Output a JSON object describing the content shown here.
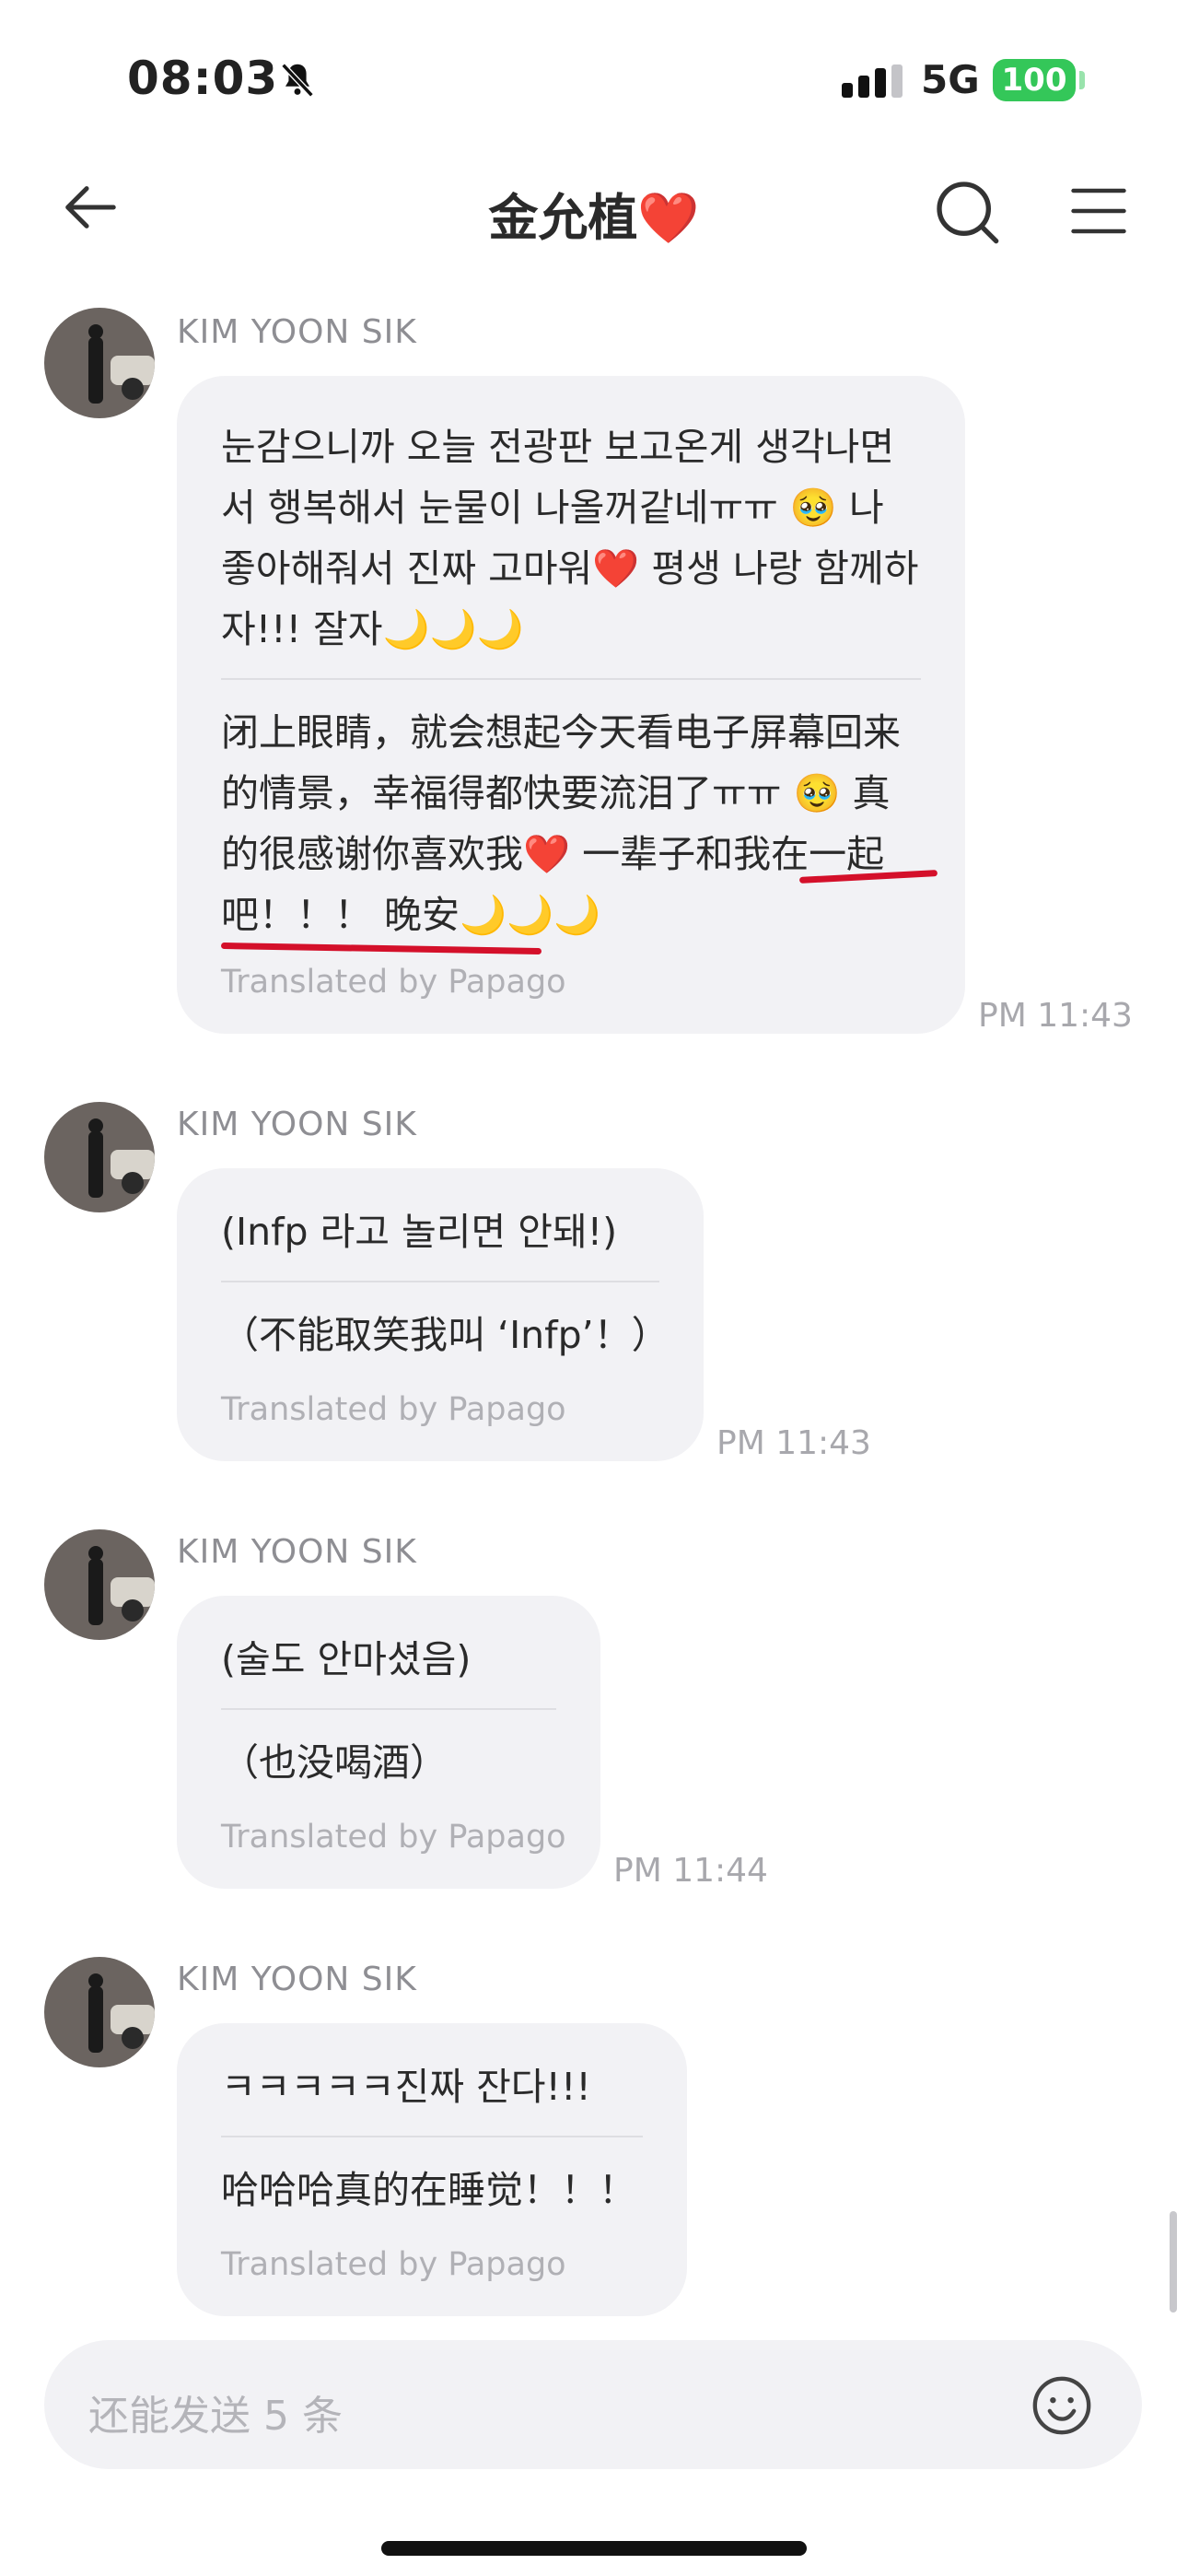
{
  "status_bar": {
    "time": "08:03",
    "network": "5G",
    "battery": "100"
  },
  "header": {
    "title": "金允植❤️"
  },
  "messages": [
    {
      "sender": "KIM YOON SIK",
      "original": "눈감으니까 오늘 전광판 보고온게 생각나면서 행복해서 눈물이 나올꺼같네ㅠㅠ 🥹 나 좋아해줘서 진짜 고마워❤️ 평생 나랑 함께하자!!! 잘자🌙🌙🌙",
      "translation": "闭上眼睛，就会想起今天看电子屏幕回来的情景，幸福得都快要流泪了ㅠㅠ 🥹 真的很感谢你喜欢我❤️ 一辈子和我在一起吧！！！ 晚安🌙🌙🌙",
      "translated_by": "Translated by Papago",
      "time": "PM 11:43"
    },
    {
      "sender": "KIM YOON SIK",
      "original": "(Infp 라고 놀리면 안돼!)",
      "translation": "（不能取笑我叫 ‘Infp’！）",
      "translated_by": "Translated by Papago",
      "time": "PM 11:43"
    },
    {
      "sender": "KIM YOON SIK",
      "original": "(술도 안마셨음)",
      "translation": "（也没喝酒）",
      "translated_by": "Translated by Papago",
      "time": "PM 11:44"
    },
    {
      "sender": "KIM YOON SIK",
      "original": "ㅋㅋㅋㅋㅋ진짜 잔다!!!",
      "translation": "哈哈哈真的在睡觉！！！",
      "translated_by": "Translated by Papago",
      "time": ""
    }
  ],
  "input": {
    "placeholder": "还能发送 5 条"
  },
  "colors": {
    "bubble": "#f2f2f5",
    "battery": "#34c759",
    "annotation": "#d4102a"
  }
}
